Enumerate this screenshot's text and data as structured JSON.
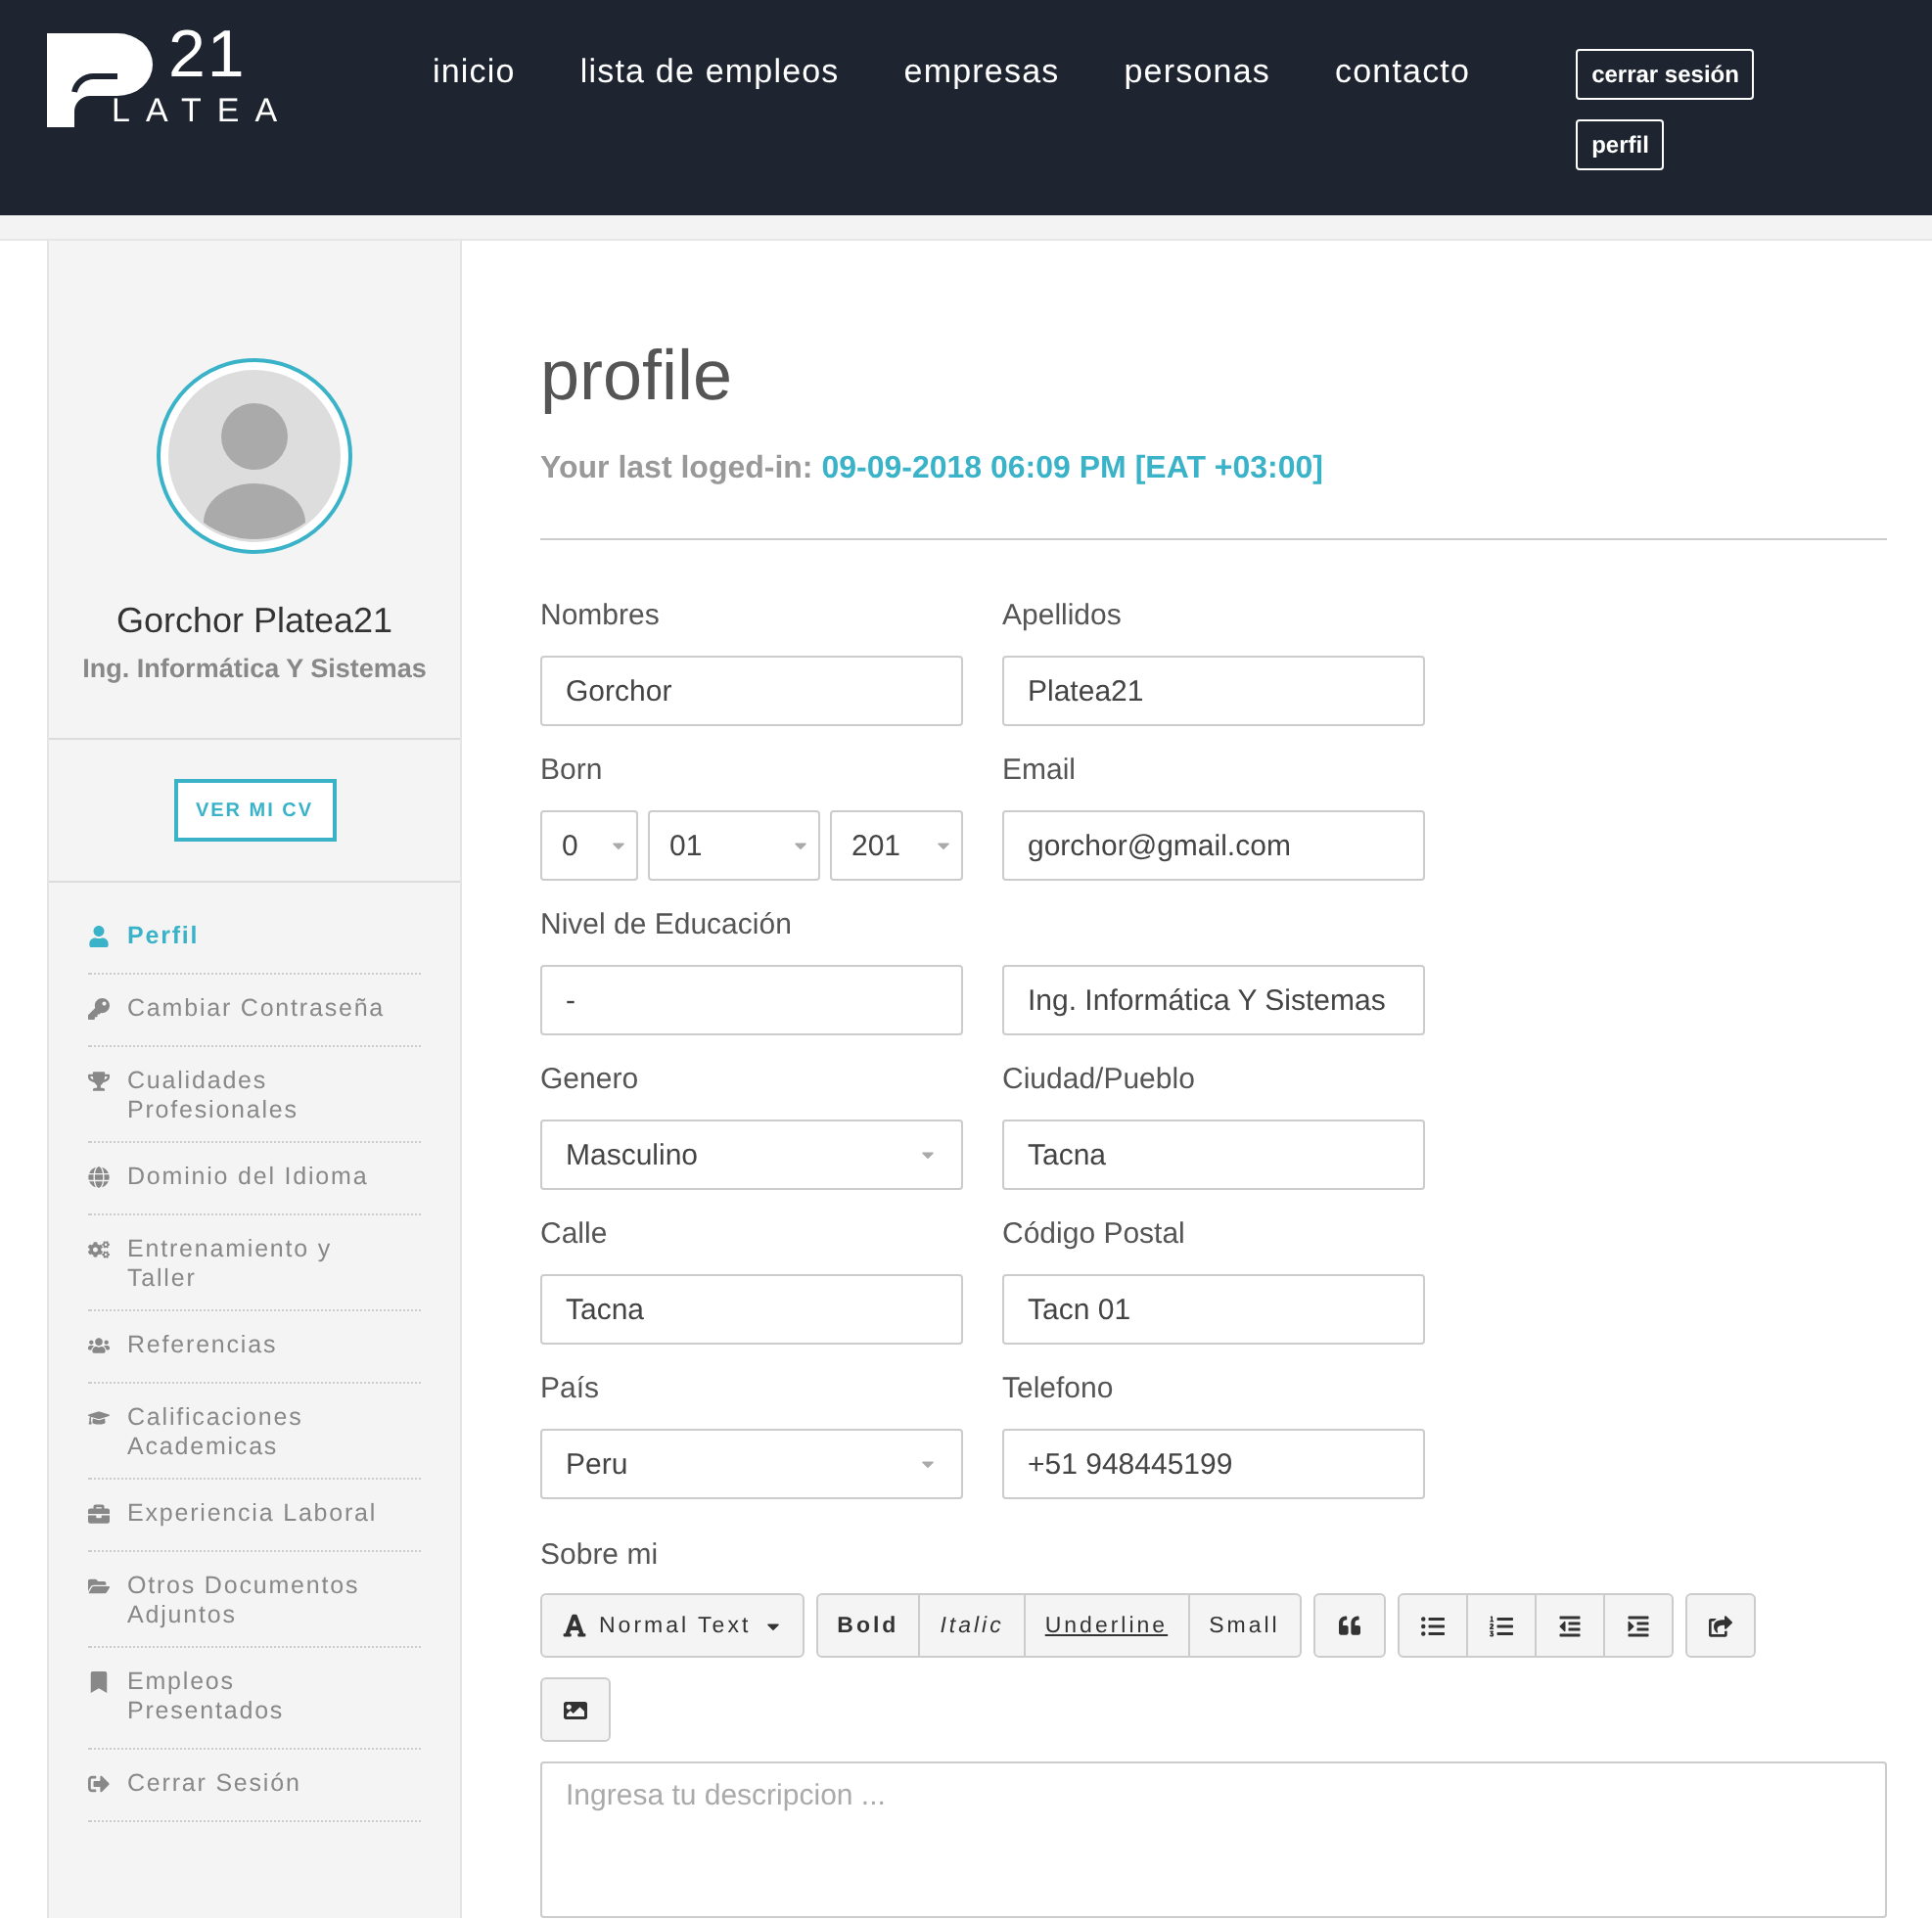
{
  "logo": {
    "number": "21",
    "word": "LATEA"
  },
  "nav": {
    "links": [
      {
        "label": "inicio"
      },
      {
        "label": "lista de empleos"
      },
      {
        "label": "empresas"
      },
      {
        "label": "personas"
      },
      {
        "label": "contacto"
      }
    ],
    "buttons": [
      "cerrar sesión",
      "perfil"
    ]
  },
  "sidebar": {
    "name": "Gorchor Platea21",
    "subtitle": "Ing. Informática Y Sistemas",
    "cv_button": "VER MI CV",
    "items": [
      {
        "label": "Perfil",
        "selected": true
      },
      {
        "label": "Cambiar Contraseña",
        "selected": false
      },
      {
        "label": "Cualidades Profesionales",
        "selected": false
      },
      {
        "label": "Dominio del Idioma",
        "selected": false
      },
      {
        "label": "Entrenamiento y Taller",
        "selected": false
      },
      {
        "label": "Referencias",
        "selected": false
      },
      {
        "label": "Calificaciones Academicas",
        "selected": false
      },
      {
        "label": "Experiencia Laboral",
        "selected": false
      },
      {
        "label": "Otros Documentos Adjuntos",
        "selected": false
      },
      {
        "label": "Empleos Presentados",
        "selected": false
      },
      {
        "label": "Cerrar Sesión",
        "selected": false
      }
    ]
  },
  "main": {
    "title": "profile",
    "last_login_label": "Your last loged-in:",
    "last_login_value": "09-09-2018 06:09 PM [EAT +03:00]",
    "rows": [
      {
        "cells": [
          {
            "label": "Nombres",
            "fields": [
              {
                "kind": "input",
                "value": "Gorchor"
              }
            ]
          },
          {
            "label": "Apellidos",
            "fields": [
              {
                "kind": "input",
                "value": "Platea21"
              }
            ]
          }
        ]
      },
      {
        "cells": [
          {
            "label": "Born",
            "fields": [
              {
                "kind": "select",
                "value": "0"
              },
              {
                "kind": "select",
                "value": "01"
              },
              {
                "kind": "select",
                "value": "201"
              }
            ]
          },
          {
            "label": "Email",
            "fields": [
              {
                "kind": "input",
                "value": "gorchor@gmail.com"
              }
            ]
          }
        ]
      },
      {
        "cells": [
          {
            "label": "Nivel de Educación",
            "fields": [
              {
                "kind": "input",
                "value": "-"
              }
            ]
          },
          {
            "fields": [
              {
                "kind": "input",
                "value": "Ing. Informática Y Sistemas"
              }
            ]
          }
        ]
      },
      {
        "cells": [
          {
            "label": "Genero",
            "fields": [
              {
                "kind": "select",
                "value": "Masculino"
              }
            ]
          },
          {
            "label": "Ciudad/Pueblo",
            "fields": [
              {
                "kind": "input",
                "value": "Tacna"
              }
            ]
          }
        ]
      },
      {
        "cells": [
          {
            "label": "Calle",
            "fields": [
              {
                "kind": "input",
                "value": "Tacna"
              }
            ]
          },
          {
            "label": "Código Postal",
            "fields": [
              {
                "kind": "input",
                "value": "Tacn 01"
              }
            ]
          }
        ]
      },
      {
        "cells": [
          {
            "label": "País",
            "fields": [
              {
                "kind": "select",
                "value": "Peru"
              }
            ]
          },
          {
            "label": "Telefono",
            "fields": [
              {
                "kind": "input",
                "value": "+51 948445199"
              }
            ]
          }
        ]
      }
    ],
    "about_label": "Sobre mi",
    "toolbar": {
      "style_menu": "Normal Text",
      "text_buttons": [
        {
          "label": "Bold",
          "kind": "bold"
        },
        {
          "label": "Italic",
          "kind": "italic"
        },
        {
          "label": "Underline",
          "kind": "underline"
        },
        {
          "label": "Small",
          "kind": "small"
        }
      ]
    },
    "about_placeholder": "Ingresa tu descripcion ..."
  }
}
